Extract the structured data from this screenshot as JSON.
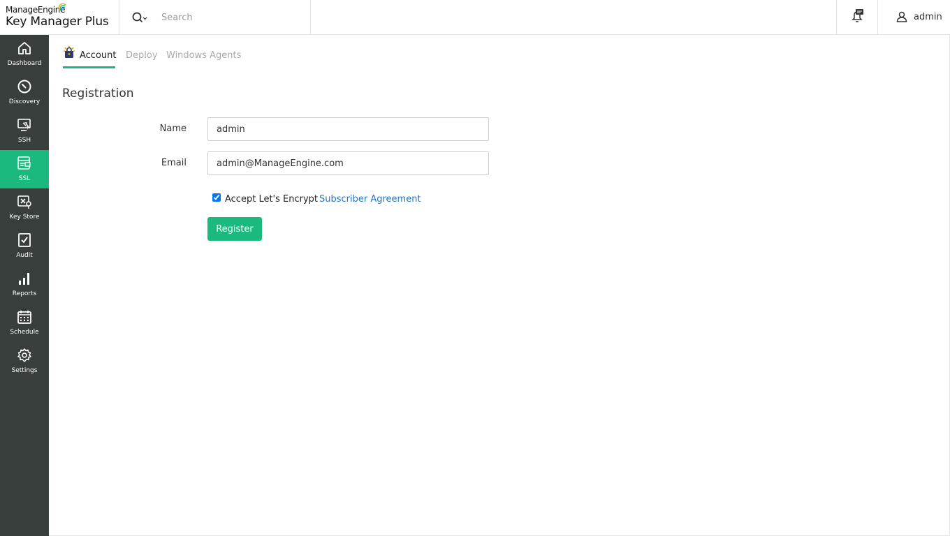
{
  "brand": {
    "company": "ManageEngine",
    "product": "Key Manager Plus"
  },
  "header": {
    "search_placeholder": "Search",
    "user_name": "admin"
  },
  "sidebar": {
    "items": [
      {
        "label": "Dashboard",
        "icon": "home-icon",
        "active": false
      },
      {
        "label": "Discovery",
        "icon": "compass-icon",
        "active": false
      },
      {
        "label": "SSH",
        "icon": "ssh-monitor-icon",
        "active": false
      },
      {
        "label": "SSL",
        "icon": "ssl-certificate-icon",
        "active": true
      },
      {
        "label": "Key Store",
        "icon": "key-store-icon",
        "active": false
      },
      {
        "label": "Audit",
        "icon": "audit-check-icon",
        "active": false
      },
      {
        "label": "Reports",
        "icon": "bar-chart-icon",
        "active": false
      },
      {
        "label": "Schedule",
        "icon": "calendar-icon",
        "active": false
      },
      {
        "label": "Settings",
        "icon": "gear-icon",
        "active": false
      }
    ]
  },
  "tabs": {
    "account": "Account",
    "deploy": "Deploy",
    "windows_agents": "Windows Agents",
    "active": "Account"
  },
  "registration": {
    "title": "Registration",
    "name_label": "Name",
    "name_value": "admin",
    "email_label": "Email",
    "email_value": "admin@ManageEngine.com",
    "accept_text": "Accept Let's Encrypt",
    "agreement_link": "Subscriber Agreement",
    "accepted": true,
    "register_button": "Register"
  },
  "colors": {
    "accent": "#1cb97f",
    "sidebar_bg": "#373e3b",
    "link": "#1f77c1"
  }
}
